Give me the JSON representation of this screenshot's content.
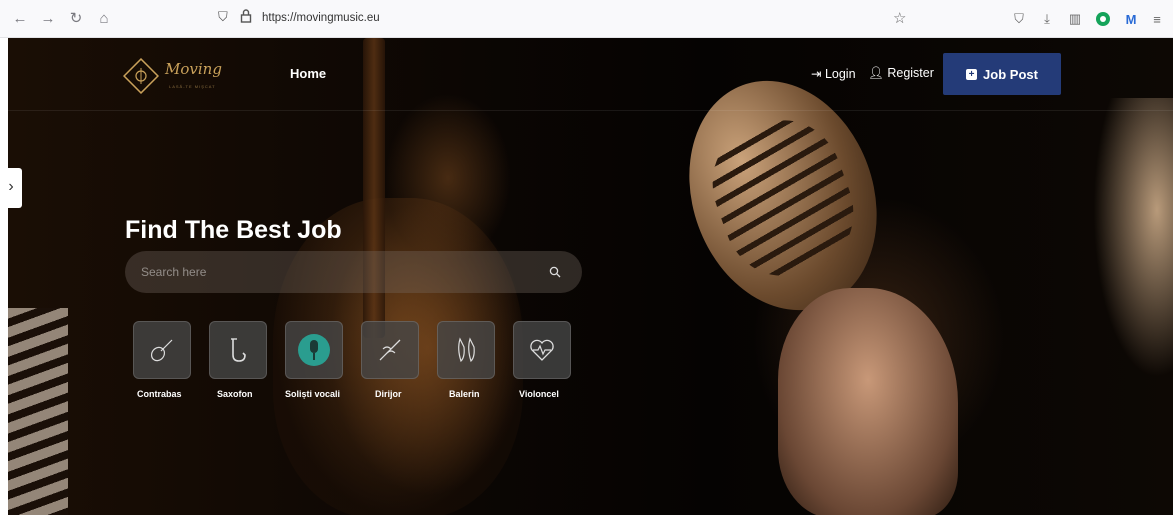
{
  "browser": {
    "url": "https://movingmusic.eu"
  },
  "header": {
    "logo_text": "Moving",
    "logo_tagline": "LASĂ-TE MIŞCAT",
    "nav_home": "Home",
    "login_label": "Login",
    "register_label": "Register",
    "job_post_label": "Job Post"
  },
  "hero": {
    "title": "Find The Best Job",
    "search_placeholder": "Search here"
  },
  "categories": [
    {
      "label": "Contrabas",
      "icon": "violin-icon"
    },
    {
      "label": "Saxofon",
      "icon": "saxophone-icon"
    },
    {
      "label": "Soliști vocali",
      "icon": "microphone-icon"
    },
    {
      "label": "Dirijor",
      "icon": "baton-icon"
    },
    {
      "label": "Balerin",
      "icon": "ballet-shoes-icon"
    },
    {
      "label": "Violoncel",
      "icon": "heartbeat-icon"
    }
  ],
  "colors": {
    "accent": "#243b78",
    "highlight": "#2a9d8f",
    "logo_gold": "#c9a15a"
  }
}
